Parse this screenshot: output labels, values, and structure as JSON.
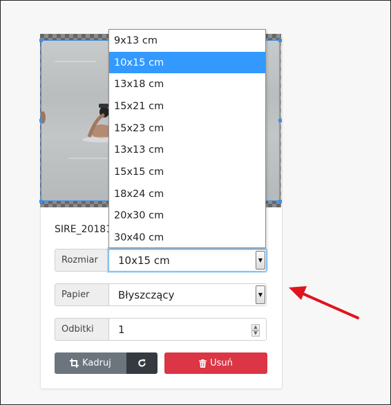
{
  "photo_card": {
    "filename": "SIRE_20181"
  },
  "size_select": {
    "label": "Rozmiar",
    "value": "10x15 cm",
    "options": [
      {
        "label": "9x13 cm",
        "selected": false
      },
      {
        "label": "10x15 cm",
        "selected": true
      },
      {
        "label": "13x18 cm",
        "selected": false
      },
      {
        "label": "15x21 cm",
        "selected": false
      },
      {
        "label": "15x23 cm",
        "selected": false
      },
      {
        "label": "13x13 cm",
        "selected": false
      },
      {
        "label": "15x15 cm",
        "selected": false
      },
      {
        "label": "18x24 cm",
        "selected": false
      },
      {
        "label": "20x30 cm",
        "selected": false
      },
      {
        "label": "30x40 cm",
        "selected": false
      }
    ]
  },
  "paper_select": {
    "label": "Papier",
    "value": "Błyszczący"
  },
  "copies": {
    "label": "Odbitki",
    "value": "1"
  },
  "actions": {
    "crop_label": "Kadruj",
    "rotate_icon": "rotate-icon",
    "delete_label": "Usuń"
  },
  "colors": {
    "selection_blue": "#3399ff",
    "crop_gray": "#6c757d",
    "rotate_dark": "#343a40",
    "delete_red": "#dc3545",
    "annotation_arrow": "#e0141e"
  }
}
